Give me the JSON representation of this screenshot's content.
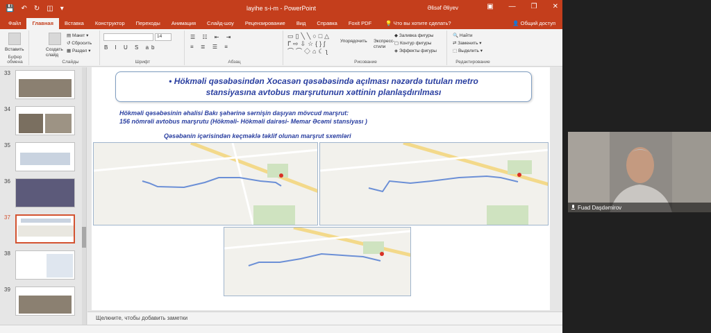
{
  "window": {
    "title": "layihe s-i-m - PowerPoint",
    "user": "Əlisəf Əliyev",
    "share": "Общий доступ",
    "tell_me": "Что вы хотите сделать?"
  },
  "tabs": [
    {
      "label": "Файл"
    },
    {
      "label": "Главная",
      "active": true
    },
    {
      "label": "Вставка"
    },
    {
      "label": "Конструктор"
    },
    {
      "label": "Переходы"
    },
    {
      "label": "Анимация"
    },
    {
      "label": "Слайд-шоу"
    },
    {
      "label": "Рецензирование"
    },
    {
      "label": "Вид"
    },
    {
      "label": "Справка"
    },
    {
      "label": "Foxit PDF"
    }
  ],
  "ribbon": {
    "paste": "Вставить",
    "clipboard_label": "Буфер обмена",
    "new_slide": "Создать слайд",
    "layout": "Макет",
    "reset": "Сбросить",
    "section": "Раздел",
    "slides_label": "Слайды",
    "font_size": "14",
    "font_label": "Шрифт",
    "paragraph_label": "Абзац",
    "arrange": "Упорядочить",
    "quick_styles": "Экспресс-стили",
    "shape_fill": "Заливка фигуры",
    "shape_outline": "Контур фигуры",
    "shape_effects": "Эффекты фигуры",
    "drawing_label": "Рисование",
    "find": "Найти",
    "replace": "Заменить",
    "select": "Выделить",
    "editing_label": "Редактирование"
  },
  "thumbnails": [
    {
      "num": "33"
    },
    {
      "num": "34"
    },
    {
      "num": "35"
    },
    {
      "num": "36"
    },
    {
      "num": "37",
      "selected": true
    },
    {
      "num": "38"
    },
    {
      "num": "39"
    }
  ],
  "slide": {
    "title_line1": "•   Hökməli qəsəbəsindən Xocasən qəsəbəsində açılması nəzərdə tutulan metro",
    "title_line2": "stansiyasına avtobus marşrutunun xəttinin planlaşdırılması",
    "sub_line1": "Hökməli qəsəbəsinin əhalisi Bakı şəhərinə sərnişin daşıyan mövcud marşrut:",
    "sub_line2": "156 nömrəli avtobus marşrutu (Hökməli- Hökməli dairəsi- Memar Əcəmi stansiyası )",
    "scheme_label": "Qəsəbənin içərisindən  keçməklə təklif olunan marşrut sxemləri"
  },
  "notes": "Щелкните, чтобы добавить заметки",
  "webcam": {
    "name": "Fuad Daşdəmirov"
  },
  "colors": {
    "accent": "#c43e1c",
    "slide_text": "#2a3fa0",
    "route": "#6b8fd6"
  }
}
